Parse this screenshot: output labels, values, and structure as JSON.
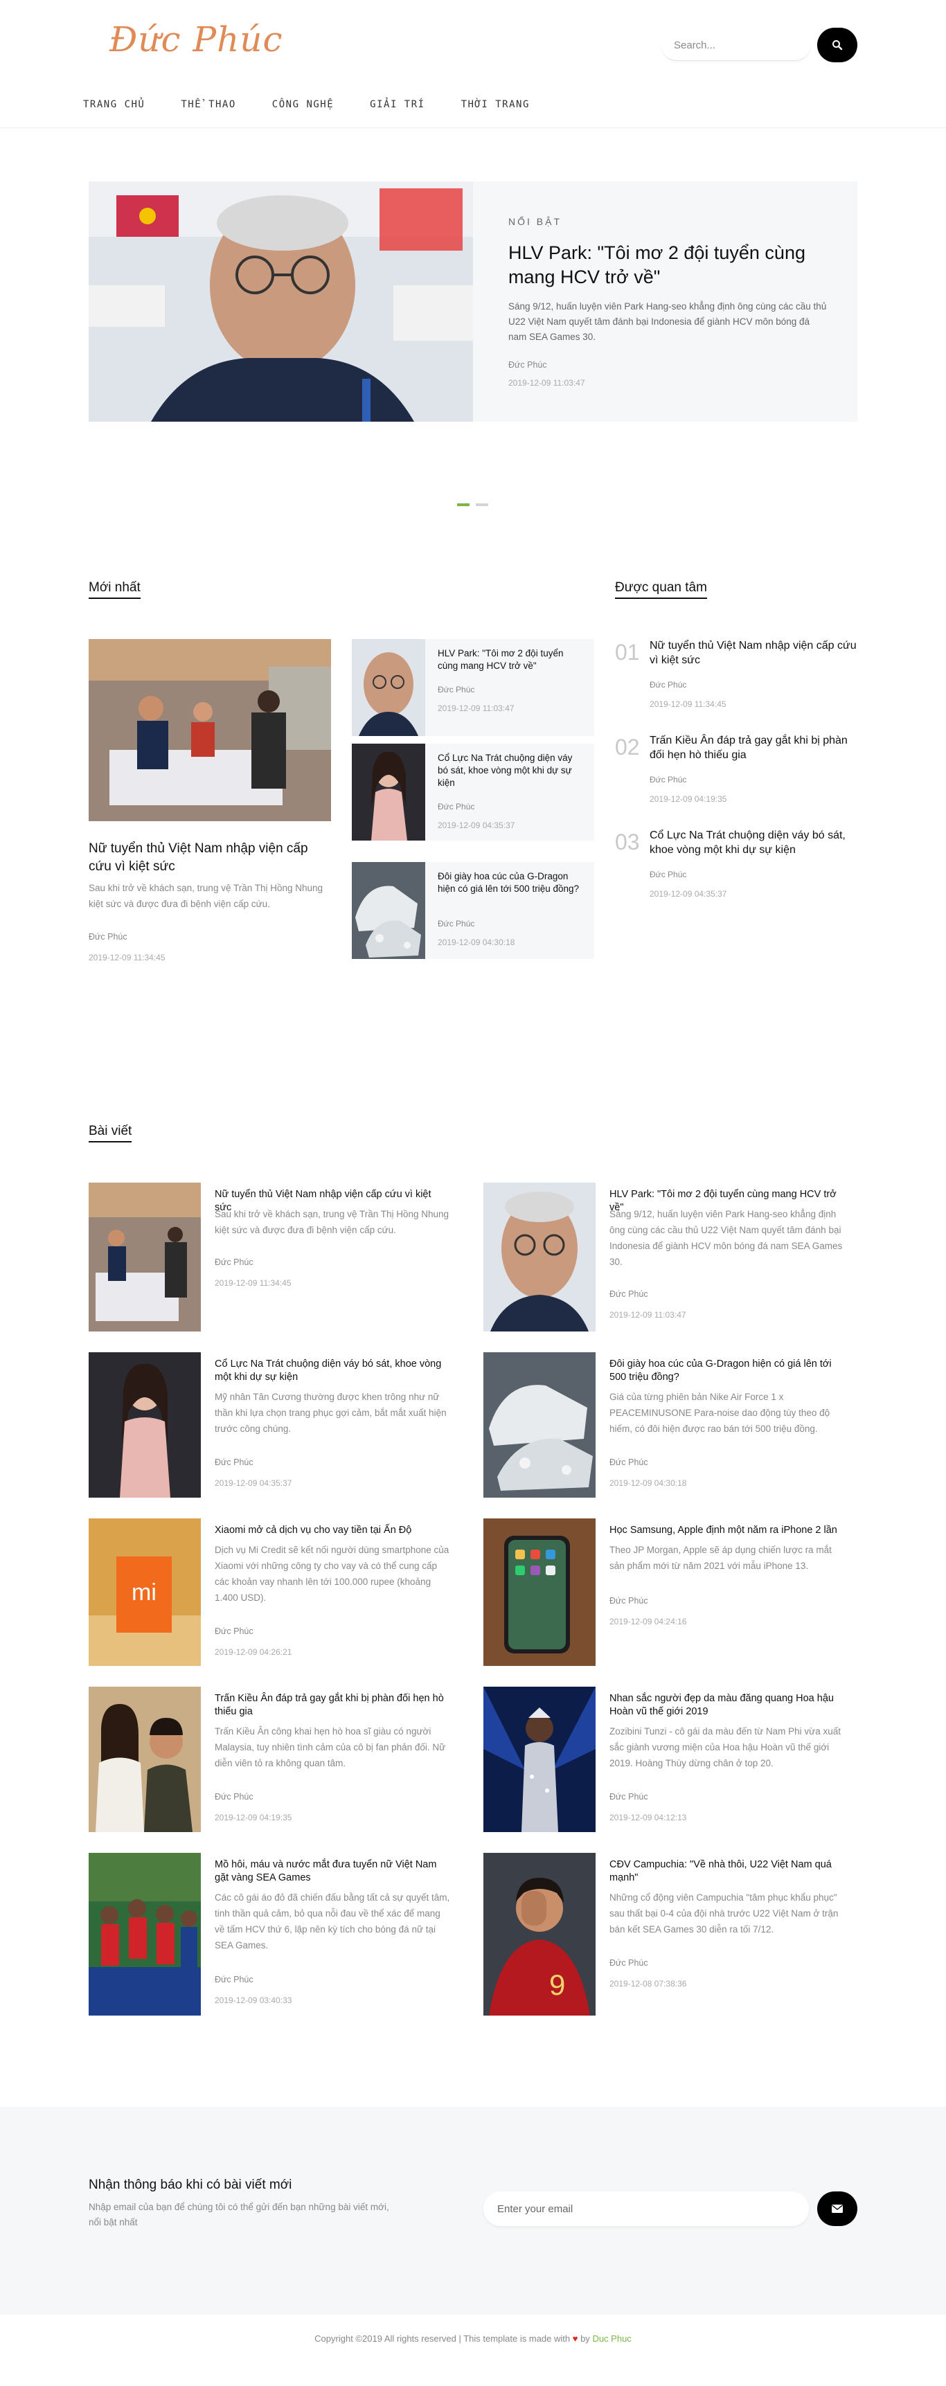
{
  "header": {
    "logo": "Đức Phúc",
    "search_placeholder": "Search...",
    "nav": [
      "TRANG CHỦ",
      "THỂ THAO",
      "CÔNG NGHỆ",
      "GIẢI TRÍ",
      "THỜI TRANG"
    ]
  },
  "hero": {
    "kicker": "NỔI BẬT",
    "title": "HLV Park: \"Tôi mơ 2 đội tuyển cùng mang HCV trở về\"",
    "excerpt": "Sáng 9/12, huấn luyện viên Park Hang-seo khẳng định ông cùng các cầu thủ U22 Việt Nam quyết tâm đánh bại Indonesia để giành HCV môn bóng đá nam SEA Games 30.",
    "author": "Đức Phúc",
    "date": "2019-12-09 11:03:47"
  },
  "latest": {
    "section_title": "Mới nhất",
    "feature": {
      "title": "Nữ tuyển thủ Việt Nam nhập viện cấp cứu vì kiệt sức",
      "excerpt": "Sau khi trở về khách sạn, trung vệ Trần Thị Hồng Nhung kiệt sức và được đưa đi bệnh viện cấp cứu.",
      "author": "Đức Phúc",
      "date": "2019-12-09 11:34:45"
    },
    "items": [
      {
        "title": "HLV Park: \"Tôi mơ 2 đội tuyển cùng mang HCV trở về\"",
        "author": "Đức Phúc",
        "date": "2019-12-09 11:03:47"
      },
      {
        "title": "Cổ Lực Na Trát chuộng diện váy bó sát, khoe vòng một khi dự sự kiện",
        "author": "Đức Phúc",
        "date": "2019-12-09 04:35:37"
      },
      {
        "title": "Đôi giày hoa cúc của G-Dragon hiện có giá lên tới 500 triệu đồng?",
        "author": "Đức Phúc",
        "date": "2019-12-09 04:30:18"
      }
    ]
  },
  "popular": {
    "section_title": "Được quan tâm",
    "items": [
      {
        "num": "01",
        "title": "Nữ tuyển thủ Việt Nam nhập viện cấp cứu vì kiệt sức",
        "author": "Đức Phúc",
        "date": "2019-12-09 11:34:45"
      },
      {
        "num": "02",
        "title": "Trấn Kiều Ân đáp trả gay gắt khi bị phàn đối hẹn hò thiếu gia",
        "author": "Đức Phúc",
        "date": "2019-12-09 04:19:35"
      },
      {
        "num": "03",
        "title": "Cổ Lực Na Trát chuộng diện váy bó sát, khoe vòng một khi dự sự kiện",
        "author": "Đức Phúc",
        "date": "2019-12-09 04:35:37"
      }
    ]
  },
  "articles": {
    "section_title": "Bài viết",
    "items": [
      {
        "title": "Nữ tuyển thủ Việt Nam nhập viện cấp cứu vì kiệt sức",
        "excerpt": "Sau khi trở về khách sạn, trung vệ Trần Thị Hồng Nhung kiệt sức và được đưa đi bệnh viện cấp cứu.",
        "author": "Đức Phúc",
        "date": "2019-12-09 11:34:45"
      },
      {
        "title": "HLV Park: \"Tôi mơ 2 đội tuyển cùng mang HCV trở về\"",
        "excerpt": "Sáng 9/12, huấn luyện viên Park Hang-seo khẳng định ông cùng các cầu thủ U22 Việt Nam quyết tâm đánh bại Indonesia để giành HCV môn bóng đá nam SEA Games 30.",
        "author": "Đức Phúc",
        "date": "2019-12-09 11:03:47"
      },
      {
        "title": "Cổ Lực Na Trát chuộng diện váy bó sát, khoe vòng một khi dự sự kiện",
        "excerpt": "Mỹ nhân Tân Cương thường được khen trông như nữ thần khi lựa chọn trang phục gợi cảm, bắt mắt xuất hiện trước công chúng.",
        "author": "Đức Phúc",
        "date": "2019-12-09 04:35:37"
      },
      {
        "title": "Đôi giày hoa cúc của G-Dragon hiện có giá lên tới 500 triệu đồng?",
        "excerpt": "Giá của từng phiên bản Nike Air Force 1 x PEACEMINUSONE Para-noise dao động tùy theo độ hiếm, có đôi hiện được rao bán tới 500 triệu đồng.",
        "author": "Đức Phúc",
        "date": "2019-12-09 04:30:18"
      },
      {
        "title": "Xiaomi mở cả dịch vụ cho vay tiền tại Ấn Độ",
        "excerpt": "Dịch vụ Mi Credit sẽ kết nối người dùng smartphone của Xiaomi với những công ty cho vay và có thể cung cấp các khoản vay nhanh lên tới 100.000 rupee (khoảng 1.400 USD).",
        "author": "Đức Phúc",
        "date": "2019-12-09 04:26:21"
      },
      {
        "title": "Học Samsung, Apple định một năm ra iPhone 2 lần",
        "excerpt": "Theo JP Morgan, Apple sẽ áp dụng chiến lược ra mắt sản phẩm mới từ năm 2021 với mẫu iPhone 13.",
        "author": "Đức Phúc",
        "date": "2019-12-09 04:24:16"
      },
      {
        "title": "Trấn Kiều Ân đáp trả gay gắt khi bị phàn đối hẹn hò thiếu gia",
        "excerpt": "Trấn Kiều Ân công khai hẹn hò hoa sĩ giàu có người Malaysia, tuy nhiên tình cảm của cô bị fan phản đối. Nữ diễn viên tỏ ra không quan tâm.",
        "author": "Đức Phúc",
        "date": "2019-12-09 04:19:35"
      },
      {
        "title": "Nhan sắc người đẹp da màu đăng quang Hoa hậu Hoàn vũ thế giới 2019",
        "excerpt": "Zozibini Tunzi - cô gái da màu đến từ Nam Phi vừa xuất sắc giành vương miện của Hoa hậu Hoàn vũ thế giới 2019. Hoàng Thùy dừng chân ở top 20.",
        "author": "Đức Phúc",
        "date": "2019-12-09 04:12:13"
      },
      {
        "title": "Mồ hôi, máu và nước mắt đưa tuyển nữ Việt Nam gặt vàng SEA Games",
        "excerpt": "Các cô gái áo đỏ đã chiến đấu bằng tất cả sự quyết tâm, tinh thần quả cảm, bỏ qua nỗi đau về thể xác để mang về tấm HCV thứ 6, lập nên kỳ tích cho bóng đá nữ tại SEA Games.",
        "author": "Đức Phúc",
        "date": "2019-12-09 03:40:33"
      },
      {
        "title": "CĐV Campuchia: \"Về nhà thôi, U22 Việt Nam quá mạnh\"",
        "excerpt": "Những cổ động viên Campuchia \"tâm phục khẩu phục\" sau thất bại 0-4 của đội nhà trước U22 Việt Nam ở trận bán kết SEA Games 30 diễn ra tối 7/12.",
        "author": "Đức Phúc",
        "date": "2019-12-08 07:38:36"
      }
    ]
  },
  "newsletter": {
    "title": "Nhận thông báo khi có bài viết mới",
    "description": "Nhập email của bạn để chúng tôi có thể gửi đến bạn những bài viết mới, nổi bật nhất",
    "placeholder": "Enter your email"
  },
  "footer": {
    "copyright": "Copyright ©2019 All rights reserved | This template is made with",
    "by": " by ",
    "brand": "Duc Phuc"
  },
  "colors": {
    "accent": "#7ab648",
    "dark": "#000000",
    "panel": "#f6f7f9",
    "heart": "#e02424"
  }
}
